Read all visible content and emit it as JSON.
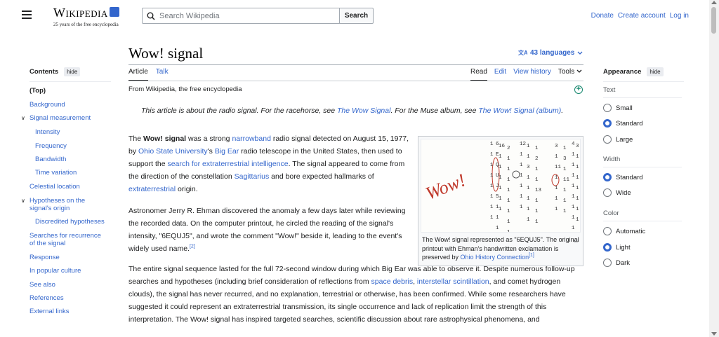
{
  "header": {
    "logo_word": "Wikipedia",
    "logo_tagline": "25 years of the free encyclopedia",
    "search_placeholder": "Search Wikipedia",
    "search_button": "Search",
    "links": [
      "Donate",
      "Create account",
      "Log in"
    ]
  },
  "page": {
    "title": "Wow! signal",
    "languages": "43 languages",
    "tabs_left": [
      "Article",
      "Talk"
    ],
    "tabs_right": [
      "Read",
      "Edit",
      "View history",
      "Tools"
    ]
  },
  "toc": {
    "title": "Contents",
    "hide": "hide",
    "items": [
      "(Top)",
      "Background",
      "Signal measurement",
      "Intensity",
      "Frequency",
      "Bandwidth",
      "Time variation",
      "Celestial location",
      "Hypotheses on the signal's origin",
      "Discredited hypotheses",
      "Searches for recurrence of the signal",
      "Response",
      "In popular culture",
      "See also",
      "References",
      "External links"
    ]
  },
  "appearance": {
    "title": "Appearance",
    "hide": "hide",
    "text_label": "Text",
    "text_options": [
      "Small",
      "Standard",
      "Large"
    ],
    "text_selected": "Standard",
    "width_label": "Width",
    "width_options": [
      "Standard",
      "Wide"
    ],
    "width_selected": "Standard",
    "color_label": "Color",
    "color_options": [
      "Automatic",
      "Light",
      "Dark"
    ],
    "color_selected": "Light"
  },
  "content": {
    "from": "From Wikipedia, the free encyclopedia",
    "hatnote_a": "This article is about the radio signal. For the racehorse, see ",
    "hatnote_link1": "The Wow Signal",
    "hatnote_b": ". For the Muse album, see ",
    "hatnote_link2": "The Wow! Signal (album)",
    "hatnote_c": ".",
    "p1": {
      "a": "The ",
      "bold": "Wow! signal",
      "b": " was a strong ",
      "l1": "narrowband",
      "c": " radio signal detected on August 15, 1977, by ",
      "l2": "Ohio State University",
      "d": "'s ",
      "l3": "Big Ear",
      "e": " radio telescope in the United States, then used to support the ",
      "l4": "search for extraterrestrial intelligence",
      "f": ". The signal appeared to come from the direction of the constellation ",
      "l5": "Sagittarius",
      "g": " and bore expected hallmarks of ",
      "l6": "extraterrestrial",
      "h": " origin."
    },
    "p2": {
      "a": "Astronomer Jerry R. Ehman discovered the anomaly a few days later while reviewing the recorded data. On the computer printout, he circled the reading of the signal's intensity, \"6EQUJ5\", and wrote the comment \"Wow!\" beside it, leading to the event's widely used name.",
      "ref": "[2]"
    },
    "p3": {
      "a": "The entire signal sequence lasted for the full 72-second window during which Big Ear was able to observe it. Despite numerous follow-up searches and hypotheses (including brief consideration of reflections from ",
      "l1": "space debris",
      "b": ", ",
      "l2": "interstellar scintillation",
      "c": ", and comet hydrogen clouds), the signal has never recurred, and no explanation, terrestrial or otherwise, has been confirmed. While some researchers have suggested it could represent an extraterrestrial transmission, its single occurrence and lack of replication limit the strength of this interpretation. The Wow! signal has inspired targeted searches, scientific discussion about rare astrophysical phenomena, and"
    },
    "figure": {
      "handwriting": "Wow!",
      "cap_a": "The Wow! signal represented as \"6EQUJ5\". The original printout with Ehman's handwritten exclamation is preserved by ",
      "cap_link": "Ohio History Connection",
      "cap_ref": "[1]",
      "printout_cols": [
        "1\n1\n1\n1\n1\n1\n1\n1",
        "16\n1\n1\n1\n1\n1\n1",
        "2\n1\n1\n1\n1\n1\n1\n1\n1\n1",
        "6\nE\nQ\nU\nJ\n5\n1\n1\n1",
        "1\n1\n3\n1\n1\n1\n1\n1",
        "1\n2\n1\n1\n13\n1\n1\n1",
        "12\n1\n1\n1\n1\n1\n1",
        "3\n1\n11\n1\n1\n1\n1",
        "1\n3\n1\n11\n1\n1\n1",
        "4\n1\n1\n1\n1\n1\n1\n1\n1",
        "3\n1\n1\n1\n1\n1\n1\n1"
      ]
    }
  },
  "colors": {
    "link": "#3366cc",
    "text": "#202122",
    "accent_green": "#14866d",
    "handwriting_red": "#c0392b"
  },
  "icons": [
    "menu-icon",
    "search-icon",
    "language-icon",
    "chevron-down-icon",
    "add-icon",
    "enlarge-icon"
  ]
}
